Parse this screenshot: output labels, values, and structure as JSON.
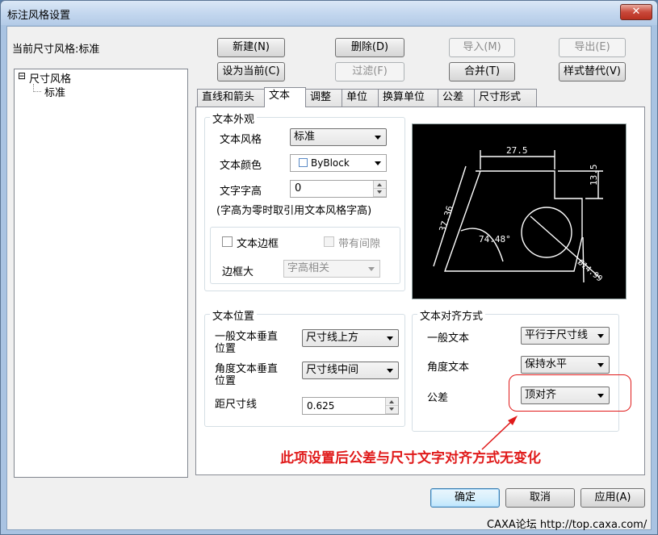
{
  "window": {
    "title": "标注风格设置",
    "close_glyph": "✕"
  },
  "current_style": {
    "label": "当前尺寸风格:标准"
  },
  "buttons": {
    "new": "新建(N)",
    "delete": "删除(D)",
    "import": "导入(M)",
    "export": "导出(E)",
    "set_current": "设为当前(C)",
    "filter": "过滤(F)",
    "merge": "合并(T)",
    "override": "样式替代(V)"
  },
  "tree": {
    "root": "尺寸风格",
    "expand_glyph": "⊟",
    "child": "标准"
  },
  "tabs": [
    {
      "label": "直线和箭头"
    },
    {
      "label": "文本"
    },
    {
      "label": "调整"
    },
    {
      "label": "单位"
    },
    {
      "label": "换算单位"
    },
    {
      "label": "公差"
    },
    {
      "label": "尺寸形式"
    }
  ],
  "text_appearance": {
    "title": "文本外观",
    "style_label": "文本风格",
    "style_value": "标准",
    "color_label": "文本颜色",
    "color_value": "ByBlock",
    "height_label": "文字字高",
    "height_value": "0",
    "note": "(字高为零时取引用文本风格字高)",
    "frame_label": "文本边框",
    "gap_label": "带有间隙",
    "frame_size_label": "边框大",
    "frame_size_value": "字高相关"
  },
  "preview": {
    "dim_top": "27.5",
    "dim_right": "13.5",
    "dim_left": "37.36",
    "dim_angle": "74.48°",
    "dim_diam": "Ø14.99"
  },
  "text_position": {
    "title": "文本位置",
    "general_label_1": "一般文本垂直",
    "general_label_2": "位置",
    "general_value": "尺寸线上方",
    "angle_label_1": "角度文本垂直",
    "angle_label_2": "位置",
    "angle_value": "尺寸线中间",
    "offset_label": "距尺寸线",
    "offset_value": "0.625"
  },
  "text_alignment": {
    "title": "文本对齐方式",
    "general_label": "一般文本",
    "general_value": "平行于尺寸线",
    "angle_label": "角度文本",
    "angle_value": "保持水平",
    "tolerance_label": "公差",
    "tolerance_value": "顶对齐"
  },
  "annotation": {
    "text": "此项设置后公差与尺寸文字对齐方式无变化",
    "color": "#e01a1a"
  },
  "footer": {
    "ok": "确定",
    "cancel": "取消",
    "apply": "应用(A)",
    "watermark": "CAXA论坛 http://top.caxa.com/"
  }
}
